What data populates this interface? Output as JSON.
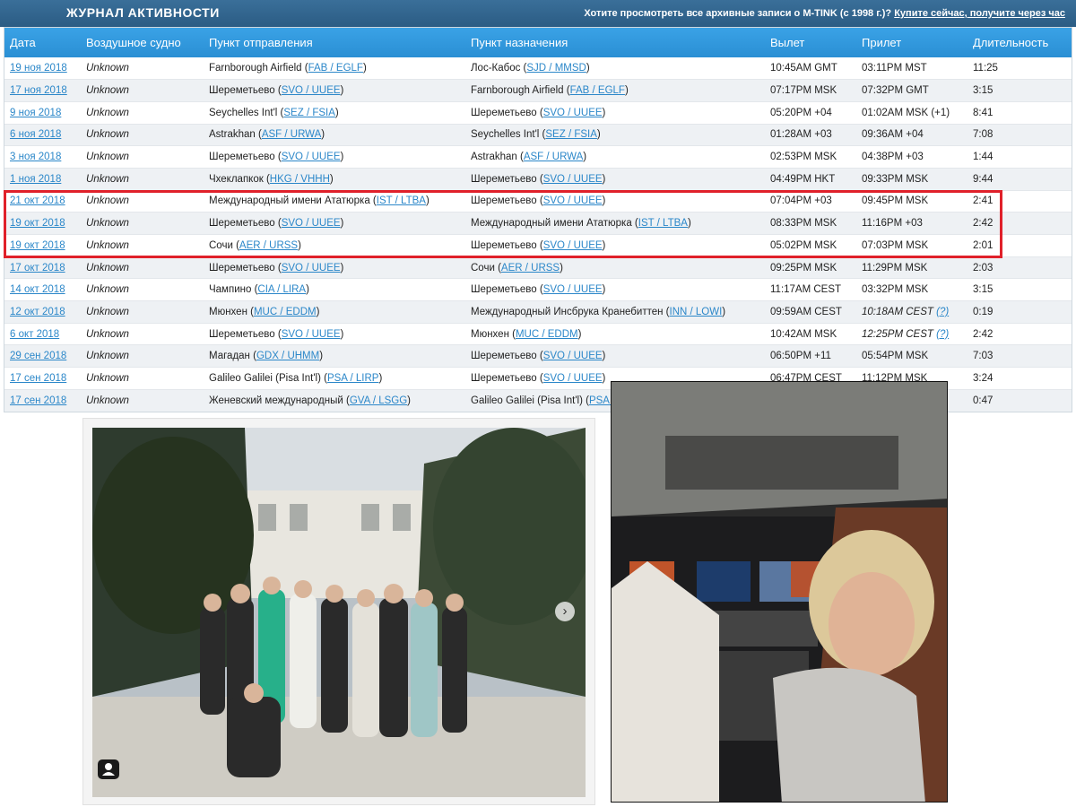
{
  "header": {
    "title": "ЖУРНАЛ АКТИВНОСТИ",
    "promo_text": "Хотите просмотреть все архивные записи о M-TINK (с 1998 г.)?",
    "promo_link": "Купите сейчас, получите через час"
  },
  "table": {
    "columns": [
      "Дата",
      "Воздушное судно",
      "Пункт отправления",
      "Пункт назначения",
      "Вылет",
      "Прилет",
      "Длительность"
    ],
    "rows": [
      {
        "date": "19 ноя 2018",
        "aircraft": "Unknown",
        "from_name": "Farnborough Airfield",
        "from_code": "FAB / EGLF",
        "to_name": "Лос-Кабос",
        "to_code": "SJD / MMSD",
        "dep": "10:45AM GMT",
        "arr": "03:11PM MST",
        "dur": "11:25"
      },
      {
        "date": "17 ноя 2018",
        "aircraft": "Unknown",
        "from_name": "Шереметьево",
        "from_code": "SVO / UUEE",
        "to_name": "Farnborough Airfield",
        "to_code": "FAB / EGLF",
        "dep": "07:17PM MSK",
        "arr": "07:32PM GMT",
        "dur": "3:15"
      },
      {
        "date": "9 ноя 2018",
        "aircraft": "Unknown",
        "from_name": "Seychelles Int'l",
        "from_code": "SEZ / FSIA",
        "to_name": "Шереметьево",
        "to_code": "SVO / UUEE",
        "dep": "05:20PM +04",
        "arr": "01:02AM MSK (+1)",
        "dur": "8:41"
      },
      {
        "date": "6 ноя 2018",
        "aircraft": "Unknown",
        "from_name": "Astrakhan",
        "from_code": "ASF / URWA",
        "to_name": "Seychelles Int'l",
        "to_code": "SEZ / FSIA",
        "dep": "01:28AM +03",
        "arr": "09:36AM +04",
        "dur": "7:08"
      },
      {
        "date": "3 ноя 2018",
        "aircraft": "Unknown",
        "from_name": "Шереметьево",
        "from_code": "SVO / UUEE",
        "to_name": "Astrakhan",
        "to_code": "ASF / URWA",
        "dep": "02:53PM MSK",
        "arr": "04:38PM +03",
        "dur": "1:44"
      },
      {
        "date": "1 ноя 2018",
        "aircraft": "Unknown",
        "from_name": "Чхеклапкок",
        "from_code": "HKG / VHHH",
        "to_name": "Шереметьево",
        "to_code": "SVO / UUEE",
        "dep": "04:49PM HKT",
        "arr": "09:33PM MSK",
        "dur": "9:44"
      },
      {
        "date": "21 окт 2018",
        "aircraft": "Unknown",
        "from_name": "Международный имени Ататюрка",
        "from_code": "IST / LTBA",
        "to_name": "Шереметьево",
        "to_code": "SVO / UUEE",
        "dep": "07:04PM +03",
        "arr": "09:45PM MSK",
        "dur": "2:41"
      },
      {
        "date": "19 окт 2018",
        "aircraft": "Unknown",
        "from_name": "Шереметьево",
        "from_code": "SVO / UUEE",
        "to_name": "Международный имени Ататюрка",
        "to_code": "IST / LTBA",
        "dep": "08:33PM MSK",
        "arr": "11:16PM +03",
        "dur": "2:42"
      },
      {
        "date": "19 окт 2018",
        "aircraft": "Unknown",
        "from_name": "Сочи",
        "from_code": "AER / URSS",
        "to_name": "Шереметьево",
        "to_code": "SVO / UUEE",
        "dep": "05:02PM MSK",
        "arr": "07:03PM MSK",
        "dur": "2:01"
      },
      {
        "date": "17 окт 2018",
        "aircraft": "Unknown",
        "from_name": "Шереметьево",
        "from_code": "SVO / UUEE",
        "to_name": "Сочи",
        "to_code": "AER / URSS",
        "dep": "09:25PM MSK",
        "arr": "11:29PM MSK",
        "dur": "2:03"
      },
      {
        "date": "14 окт 2018",
        "aircraft": "Unknown",
        "from_name": "Чампино",
        "from_code": "CIA / LIRA",
        "to_name": "Шереметьево",
        "to_code": "SVO / UUEE",
        "dep": "11:17AM CEST",
        "arr": "03:32PM MSK",
        "dur": "3:15"
      },
      {
        "date": "12 окт 2018",
        "aircraft": "Unknown",
        "from_name": "Мюнхен",
        "from_code": "MUC / EDDM",
        "to_name": "Международный Инсбрука Кранебиттен",
        "to_code": "INN / LOWI",
        "dep": "09:59AM CEST",
        "arr": "10:18AM CEST",
        "arr_q": "(?)",
        "dur": "0:19"
      },
      {
        "date": "6 окт 2018",
        "aircraft": "Unknown",
        "from_name": "Шереметьево",
        "from_code": "SVO / UUEE",
        "to_name": "Мюнхен",
        "to_code": "MUC / EDDM",
        "dep": "10:42AM MSK",
        "arr": "12:25PM CEST",
        "arr_q": "(?)",
        "dur": "2:42"
      },
      {
        "date": "29 сен 2018",
        "aircraft": "Unknown",
        "from_name": "Магадан",
        "from_code": "GDX / UHMM",
        "to_name": "Шереметьево",
        "to_code": "SVO / UUEE",
        "dep": "06:50PM +11",
        "arr": "05:54PM MSK",
        "dur": "7:03"
      },
      {
        "date": "17 сен 2018",
        "aircraft": "Unknown",
        "from_name": "Galileo Galilei (Pisa Int'l)",
        "from_code": "PSA / LIRP",
        "to_name": "Шереметьево",
        "to_code": "SVO / UUEE",
        "dep": "06:47PM CEST",
        "arr": "11:12PM MSK",
        "dur": "3:24"
      },
      {
        "date": "17 сен 2018",
        "aircraft": "Unknown",
        "from_name": "Женевский международный",
        "from_code": "GVA / LSGG",
        "to_name": "Galileo Galilei (Pisa Int'l)",
        "to_code": "PSA / LIRP",
        "dep": "",
        "arr": "",
        "dur": "0:47"
      }
    ]
  },
  "photos": {
    "group_photo": {
      "next_icon": "chevron-right-icon",
      "tag_icon": "person-tag-icon"
    },
    "cockpit_photo": {}
  }
}
